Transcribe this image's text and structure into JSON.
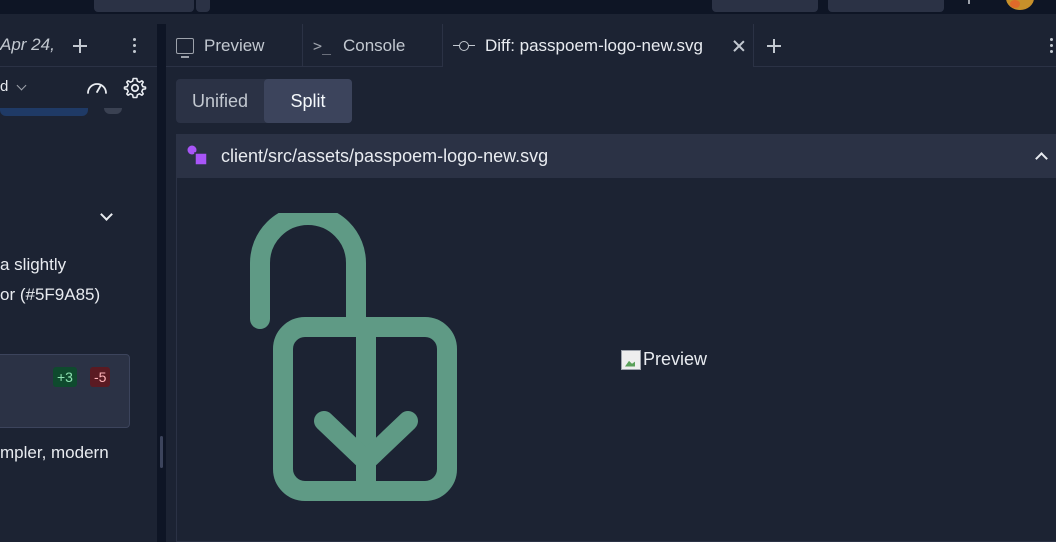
{
  "left_panel": {
    "date_tab": "Apr 24,",
    "mode_label": "d",
    "message_lines": [
      "a slightly",
      "or (#5F9A85)",
      "mpler, modern"
    ],
    "diff_stats": {
      "added": "+3",
      "removed": "-5"
    }
  },
  "tabs": [
    {
      "label": "Preview",
      "icon": "monitor-icon"
    },
    {
      "label": "Console",
      "icon": "console-icon"
    },
    {
      "label": "Diff: passpoem-logo-new.svg",
      "icon": "commit-icon",
      "active": true
    }
  ],
  "diff_view": {
    "modes": [
      "Unified",
      "Split"
    ],
    "selected_mode": "Split",
    "file_path": "client/src/assets/passpoem-logo-new.svg",
    "new_image_alt": "Preview"
  },
  "colors": {
    "logo_stroke": "#5F9A85",
    "accent_purple": "#a855f7",
    "added_bg": "#0f4a2e",
    "removed_bg": "#5a1a22"
  }
}
